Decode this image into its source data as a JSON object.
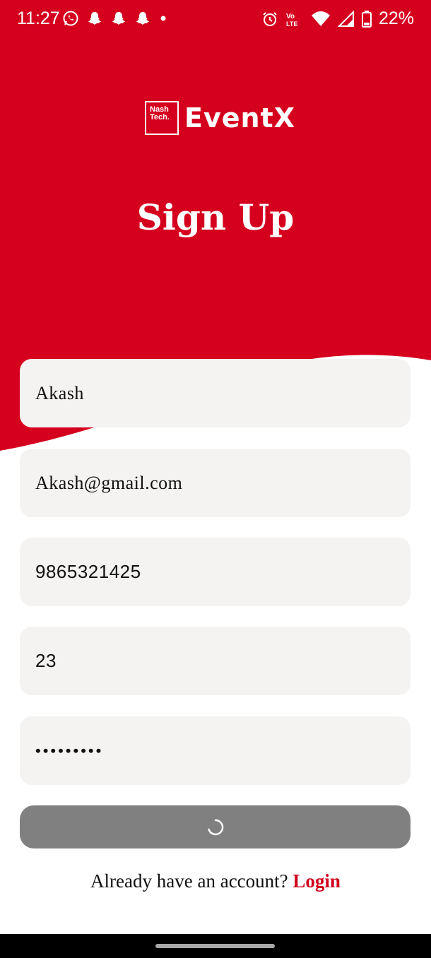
{
  "colors": {
    "brand": "#d5001e",
    "field_bg": "#f4f3f2",
    "button_disabled": "#808080",
    "link": "#d0001c"
  },
  "status_bar": {
    "time": "11:27",
    "battery": "22%",
    "left_icons": [
      "whatsapp-icon",
      "snapchat-icon",
      "snapchat-icon",
      "snapchat-icon",
      "dot-icon"
    ],
    "right_icons": [
      "alarm-icon",
      "volte-icon",
      "wifi-icon",
      "signal-icon",
      "battery-icon"
    ],
    "volte_label": "Vo LTE"
  },
  "brand": {
    "logo_line1": "Nash",
    "logo_line2": "Tech.",
    "name": "EventX"
  },
  "page": {
    "title": "Sign Up"
  },
  "form": {
    "name_value": "Akash",
    "email_value": "Akash@gmail.com",
    "phone_value": "9865321425",
    "age_value": "23",
    "password_masked": "•••••••••"
  },
  "submit": {
    "state": "loading",
    "icon": "spinner-icon"
  },
  "footer": {
    "prompt": "Already have an account? ",
    "login_label": "Login"
  }
}
